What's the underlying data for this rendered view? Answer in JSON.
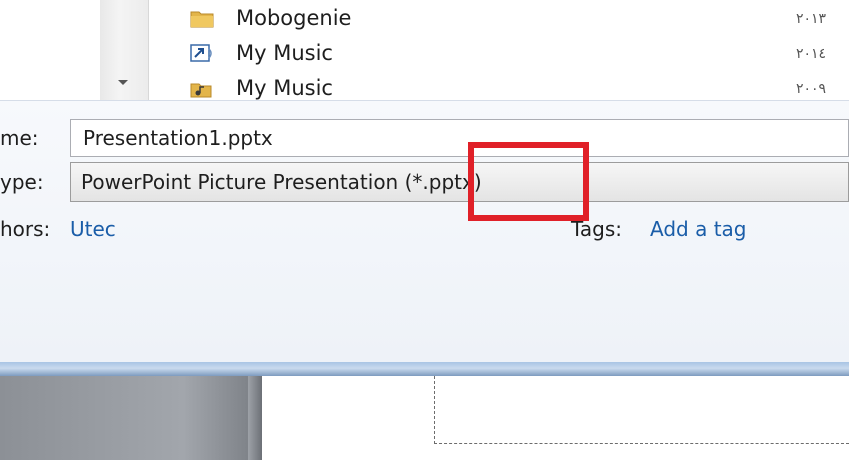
{
  "file_list": {
    "items": [
      {
        "name": "Mobogenie",
        "date": "٢٠١٣",
        "icon": "folder-icon"
      },
      {
        "name": "My Music",
        "date": "٢٠١٤",
        "icon": "shortcut-icon"
      },
      {
        "name": "My Music",
        "date": "٢٠٠٩",
        "icon": "music-folder-icon"
      }
    ]
  },
  "form": {
    "filename_label": "me:",
    "filename_value": "Presentation1.pptx",
    "savetype_label": "ype:",
    "savetype_value": "PowerPoint Picture Presentation (*.pptx)",
    "authors_label": "hors:",
    "authors_value": "Utec",
    "tags_label": "Tags:",
    "tags_value": "Add a tag"
  },
  "colors": {
    "highlight": "#e02028",
    "link": "#1a5da8"
  }
}
